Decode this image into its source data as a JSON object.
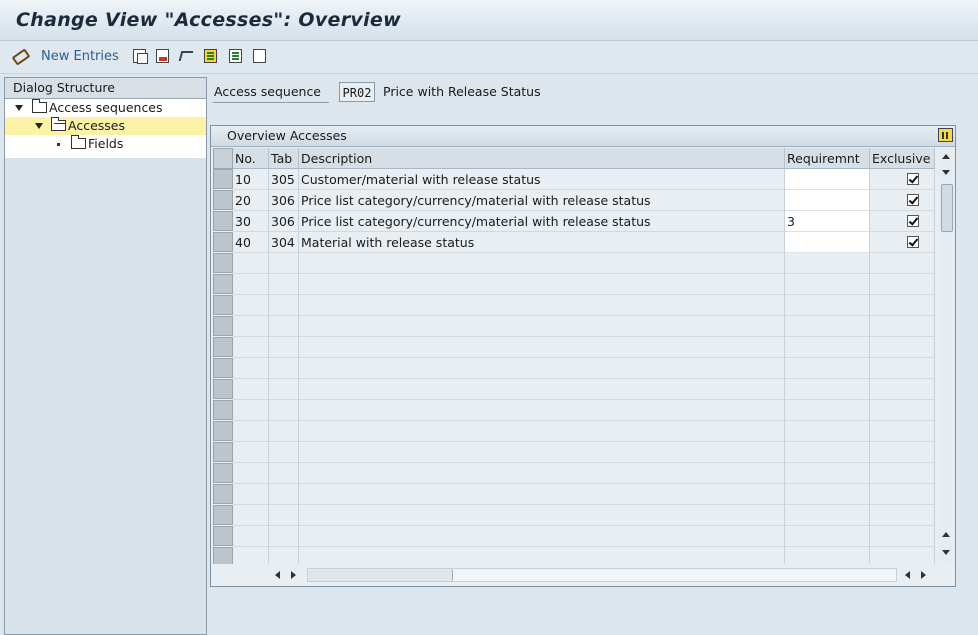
{
  "window": {
    "title": "Change View \"Accesses\": Overview"
  },
  "toolbar": {
    "new_entries_label": "New Entries"
  },
  "dialog_structure": {
    "header": "Dialog Structure",
    "items": [
      {
        "label": "Access sequences",
        "level": 1,
        "expanded": true,
        "selected": false
      },
      {
        "label": "Accesses",
        "level": 2,
        "expanded": true,
        "selected": true
      },
      {
        "label": "Fields",
        "level": 3,
        "expanded": false,
        "selected": false
      }
    ]
  },
  "access_sequence": {
    "label": "Access sequence",
    "value": "PR02",
    "description": "Price with Release Status"
  },
  "overview": {
    "title": "Overview Accesses",
    "columns": {
      "no": "No.",
      "tab": "Tab",
      "description": "Description",
      "requirement": "Requiremnt",
      "exclusive": "Exclusive"
    },
    "rows": [
      {
        "no": "10",
        "tab": "305",
        "description": "Customer/material with release status",
        "requirement": "",
        "exclusive": true
      },
      {
        "no": "20",
        "tab": "306",
        "description": "Price list category/currency/material with release status",
        "requirement": "",
        "exclusive": true
      },
      {
        "no": "30",
        "tab": "306",
        "description": "Price list category/currency/material with release status",
        "requirement": "3",
        "exclusive": true
      },
      {
        "no": "40",
        "tab": "304",
        "description": "Material with release status",
        "requirement": "",
        "exclusive": true
      }
    ],
    "empty_rows": 15
  }
}
